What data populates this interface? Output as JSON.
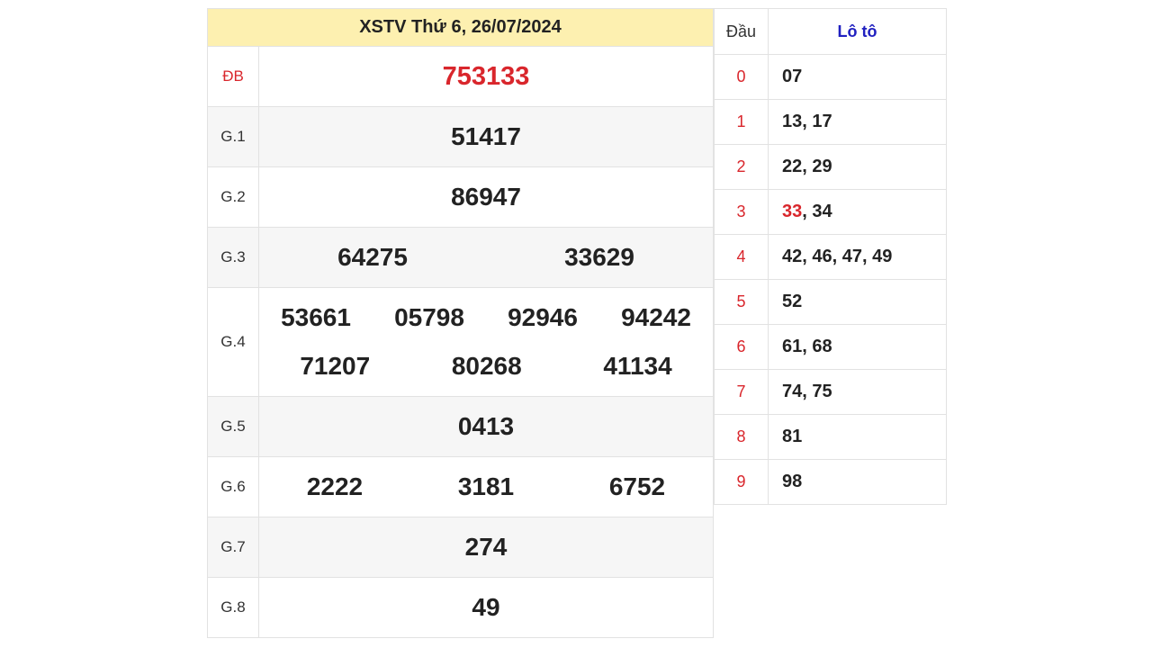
{
  "results": {
    "title": "XSTV Thứ 6, 26/07/2024",
    "prizes": [
      {
        "label": "ĐB",
        "numbers": [
          "753133"
        ]
      },
      {
        "label": "G.1",
        "numbers": [
          "51417"
        ]
      },
      {
        "label": "G.2",
        "numbers": [
          "86947"
        ]
      },
      {
        "label": "G.3",
        "numbers": [
          "64275",
          "33629"
        ]
      },
      {
        "label": "G.4",
        "numbers": [
          "53661",
          "05798",
          "92946",
          "94242",
          "71207",
          "80268",
          "41134"
        ]
      },
      {
        "label": "G.5",
        "numbers": [
          "0413"
        ]
      },
      {
        "label": "G.6",
        "numbers": [
          "2222",
          "3181",
          "6752"
        ]
      },
      {
        "label": "G.7",
        "numbers": [
          "274"
        ]
      },
      {
        "label": "G.8",
        "numbers": [
          "49"
        ]
      }
    ]
  },
  "loto": {
    "head_label": "Đầu",
    "loto_label": "Lô tô",
    "rows": [
      {
        "head": "0",
        "values": "07"
      },
      {
        "head": "1",
        "values": "13, 17"
      },
      {
        "head": "2",
        "values": "22, 29"
      },
      {
        "head": "3",
        "highlight": "33",
        "values": ", 34"
      },
      {
        "head": "4",
        "values": "42, 46, 47, 49"
      },
      {
        "head": "5",
        "values": "52"
      },
      {
        "head": "6",
        "values": "61, 68"
      },
      {
        "head": "7",
        "values": "74, 75"
      },
      {
        "head": "8",
        "values": "81"
      },
      {
        "head": "9",
        "values": "98"
      }
    ]
  },
  "colors": {
    "accent_red": "#d9262c",
    "header_yellow": "#fdf0b0",
    "loto_blue": "#2020c0"
  }
}
